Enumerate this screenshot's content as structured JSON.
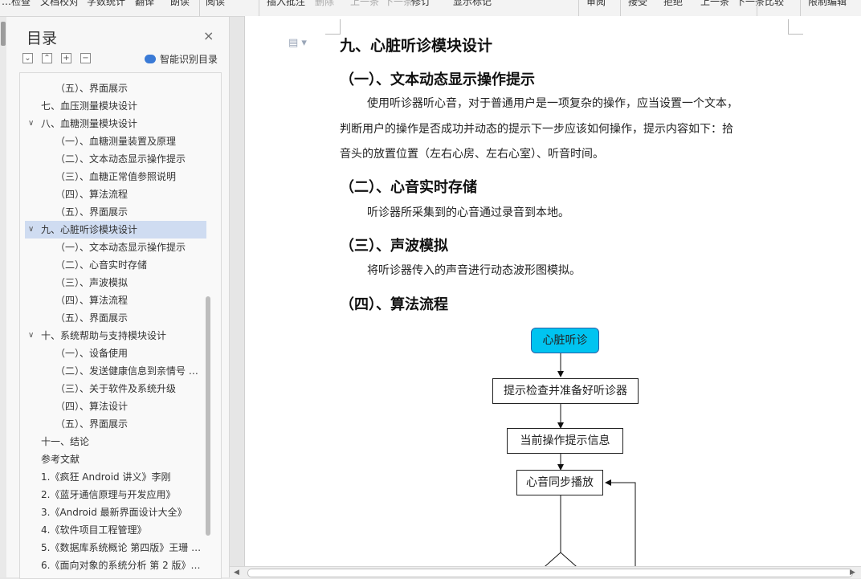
{
  "toolbar": {
    "items": [
      "…检查",
      "文档校对",
      "字数统计",
      "翻译",
      "朗读",
      "阅读",
      "插入批注",
      "删除",
      "上一条",
      "下一条",
      "修订",
      "显示标记",
      "审阅",
      "接受",
      "拒绝",
      "上一条",
      "下一条",
      "比较",
      "限制编辑"
    ]
  },
  "nav": {
    "title": "目录",
    "close_icon": "×",
    "controls": [
      "⌄",
      "⌃",
      "+",
      "−"
    ],
    "smart_label": "智能识别目录",
    "items": [
      {
        "label": "（五）、界面展示",
        "level": 2,
        "caret": ""
      },
      {
        "label": "七、血压测量模块设计",
        "level": 1,
        "caret": ""
      },
      {
        "label": "八、血糖测量模块设计",
        "level": 1,
        "caret": "v"
      },
      {
        "label": "（一）、血糖测量装置及原理",
        "level": 2,
        "caret": ""
      },
      {
        "label": "（二）、文本动态显示操作提示",
        "level": 2,
        "caret": ""
      },
      {
        "label": "（三）、血糖正常值参照说明",
        "level": 2,
        "caret": ""
      },
      {
        "label": "（四）、算法流程",
        "level": 2,
        "caret": ""
      },
      {
        "label": "（五）、界面展示",
        "level": 2,
        "caret": ""
      },
      {
        "label": "九、心脏听诊模块设计",
        "level": 1,
        "caret": "v",
        "active": true
      },
      {
        "label": "（一）、文本动态显示操作提示",
        "level": 2,
        "caret": ""
      },
      {
        "label": "（二）、心音实时存储",
        "level": 2,
        "caret": ""
      },
      {
        "label": "（三）、声波模拟",
        "level": 2,
        "caret": ""
      },
      {
        "label": "（四）、算法流程",
        "level": 2,
        "caret": ""
      },
      {
        "label": "（五）、界面展示",
        "level": 2,
        "caret": ""
      },
      {
        "label": "十、系统帮助与支持模块设计",
        "level": 1,
        "caret": "v"
      },
      {
        "label": "（一）、设备使用",
        "level": 2,
        "caret": ""
      },
      {
        "label": "（二）、发送健康信息到亲情号 …",
        "level": 2,
        "caret": ""
      },
      {
        "label": "（三）、关于软件及系统升级",
        "level": 2,
        "caret": ""
      },
      {
        "label": "（四）、算法设计",
        "level": 2,
        "caret": ""
      },
      {
        "label": "（五）、界面展示",
        "level": 2,
        "caret": ""
      },
      {
        "label": "十一、结论",
        "level": 1,
        "caret": ""
      },
      {
        "label": "参考文献",
        "level": 1,
        "caret": ""
      },
      {
        "label": "1.《疯狂 Android 讲义》李刚",
        "level": 1,
        "caret": ""
      },
      {
        "label": "2.《蓝牙通信原理与开发应用》",
        "level": 1,
        "caret": ""
      },
      {
        "label": "3.《Android 最新界面设计大全》",
        "level": 1,
        "caret": ""
      },
      {
        "label": "4.《软件项目工程管理》",
        "level": 1,
        "caret": ""
      },
      {
        "label": "5.《数据库系统概论 第四版》王珊 …",
        "level": 1,
        "caret": ""
      },
      {
        "label": "6.《面向对象的系统分析 第 2 版》…",
        "level": 1,
        "caret": ""
      }
    ]
  },
  "doc": {
    "h1": "九、心脏听诊模块设计",
    "s1_title": "（一）、文本动态显示操作提示",
    "s1_p1": "使用听诊器听心音，对于普通用户是一项复杂的操作，应当设置一个文本，",
    "s1_p2": "判断用户的操作是否成功并动态的提示下一步应该如何操作，提示内容如下：拾",
    "s1_p3": "音头的放置位置（左右心房、左右心室）、听音时间。",
    "s2_title": "（二）、心音实时存储",
    "s2_p1": "听诊器所采集到的心音通过录音到本地。",
    "s3_title": "（三）、声波模拟",
    "s3_p1": "将听诊器传入的声音进行动态波形图模拟。",
    "s4_title": "（四）、算法流程"
  },
  "flowchart": {
    "start": "心脏听诊",
    "step1": "提示检查并准备好听诊器",
    "step2": "当前操作提示信息",
    "step3": "心音同步播放",
    "start_color": "#00c4f0"
  }
}
